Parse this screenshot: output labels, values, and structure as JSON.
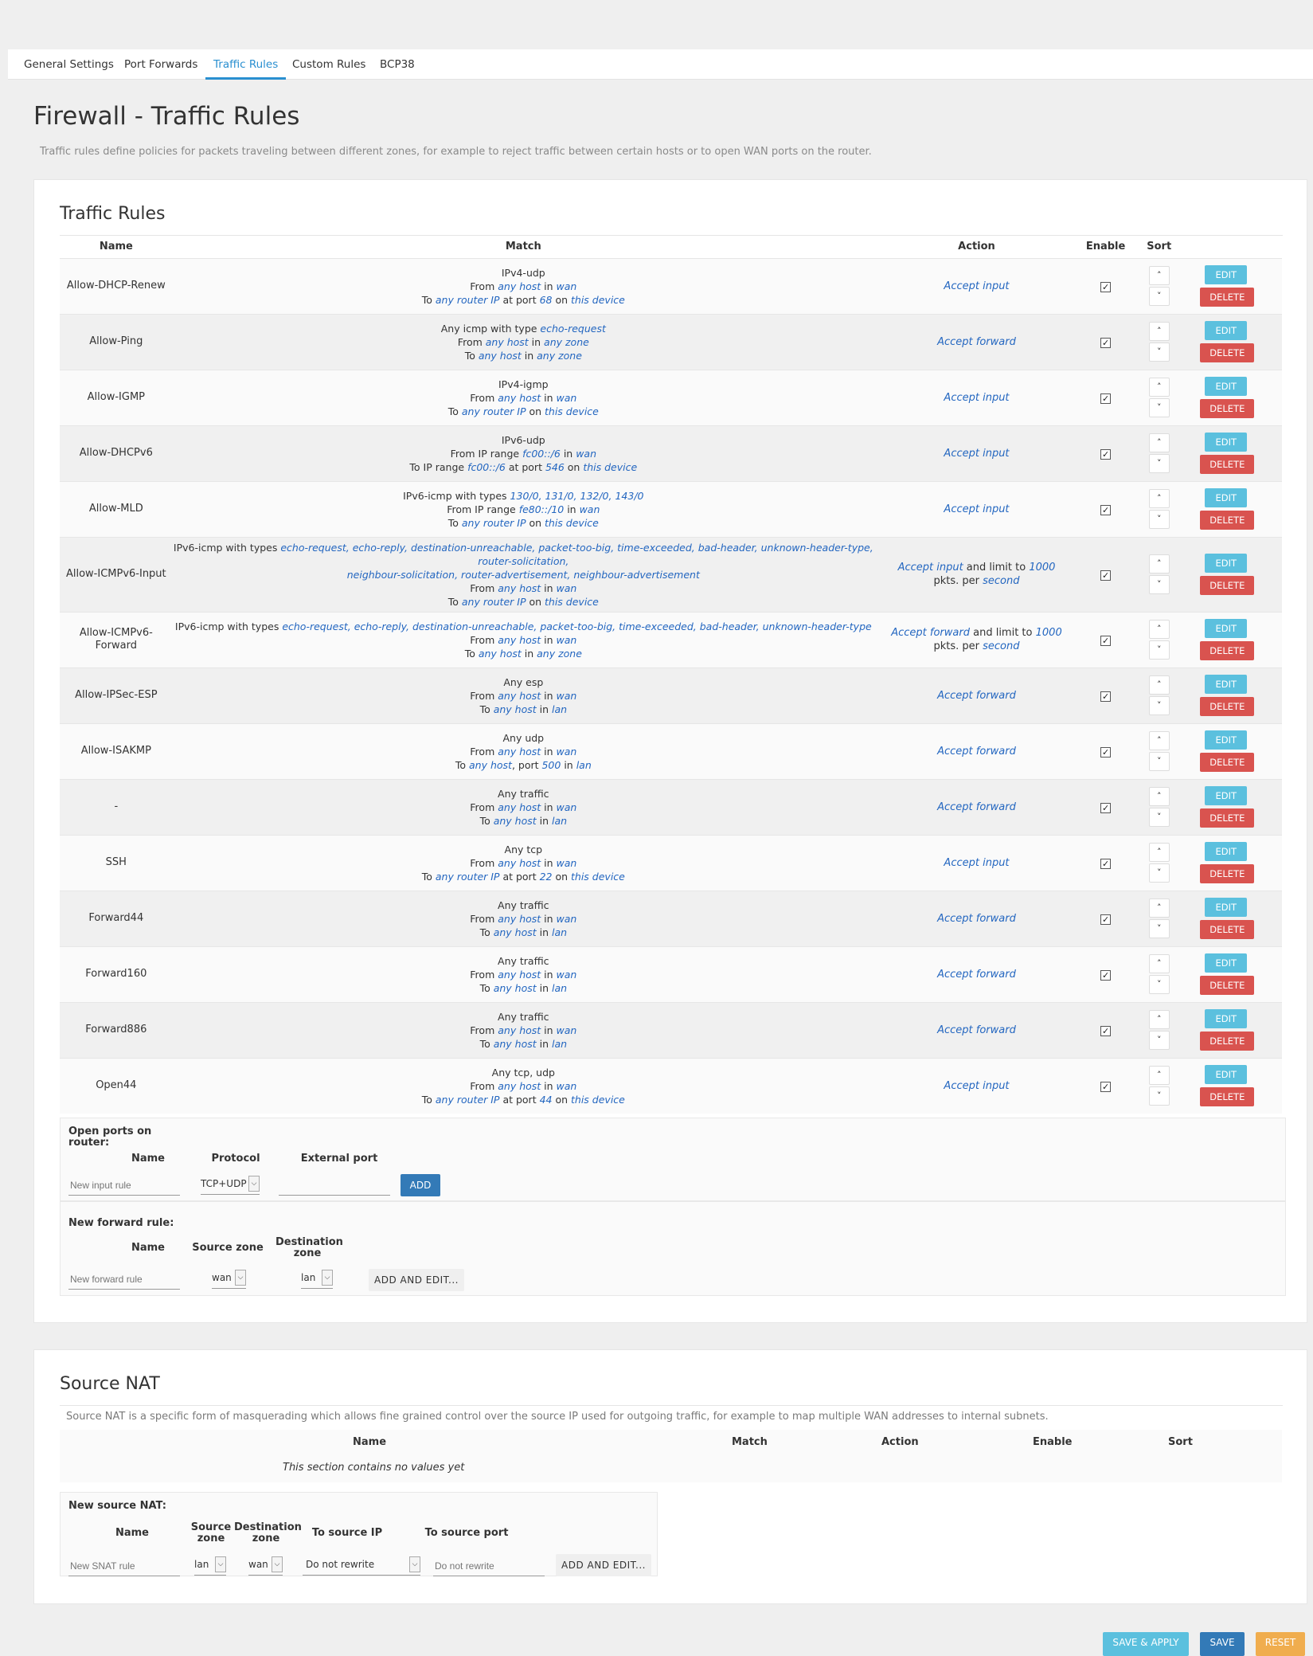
{
  "tabs": [
    "General Settings",
    "Port Forwards",
    "Traffic Rules",
    "Custom Rules",
    "BCP38"
  ],
  "page": {
    "title": "Firewall - Traffic Rules",
    "description": "Traffic rules define policies for packets traveling between different zones, for example to reject traffic between certain hosts or to open WAN ports on the router."
  },
  "traffic_rules": {
    "title": "Traffic Rules",
    "columns": [
      "Name",
      "Match",
      "Action",
      "Enable",
      "Sort"
    ],
    "edit_label": "EDIT",
    "delete_label": "DELETE",
    "rows": [
      {
        "name": "Allow-DHCP-Renew",
        "match": [
          "IPv4-udp",
          "From {any host} in {wan}",
          "To {any router IP} at port {68} on {this device}"
        ],
        "action": "{Accept input}",
        "enabled": true
      },
      {
        "name": "Allow-Ping",
        "match": [
          "Any icmp with type {echo-request}",
          "From {any host} in {any zone}",
          "To {any host} in {any zone}"
        ],
        "action": "{Accept forward}",
        "enabled": true
      },
      {
        "name": "Allow-IGMP",
        "match": [
          "IPv4-igmp",
          "From {any host} in {wan}",
          "To {any router IP} on {this device}"
        ],
        "action": "{Accept input}",
        "enabled": true
      },
      {
        "name": "Allow-DHCPv6",
        "match": [
          "IPv6-udp",
          "From IP range {fc00::/6} in {wan}",
          "To IP range {fc00::/6} at port {546} on {this device}"
        ],
        "action": "{Accept input}",
        "enabled": true
      },
      {
        "name": "Allow-MLD",
        "match": [
          "IPv6-icmp with types {130/0, 131/0, 132/0, 143/0}",
          "From IP range {fe80::/10} in {wan}",
          "To {any router IP} on {this device}"
        ],
        "action": "{Accept input}",
        "enabled": true
      },
      {
        "name": "Allow-ICMPv6-Input",
        "match": [
          "IPv6-icmp with types {echo-request, echo-reply, destination-unreachable, packet-too-big, time-exceeded, bad-header, unknown-header-type, router-solicitation,}",
          "{neighbour-solicitation, router-advertisement, neighbour-advertisement}",
          "From {any host} in {wan}",
          "To {any router IP} on {this device}"
        ],
        "action": "{Accept input} and limit to {1000} pkts. per {second}",
        "enabled": true
      },
      {
        "name": "Allow-ICMPv6-Forward",
        "match": [
          "IPv6-icmp with types {echo-request, echo-reply, destination-unreachable, packet-too-big, time-exceeded, bad-header, unknown-header-type}",
          "From {any host} in {wan}",
          "To {any host} in {any zone}"
        ],
        "action": "{Accept forward} and limit to {1000} pkts. per {second}",
        "enabled": true
      },
      {
        "name": "Allow-IPSec-ESP",
        "match": [
          "Any esp",
          "From {any host} in {wan}",
          "To {any host} in {lan}"
        ],
        "action": "{Accept forward}",
        "enabled": true
      },
      {
        "name": "Allow-ISAKMP",
        "match": [
          "Any udp",
          "From {any host} in {wan}",
          "To {any host}, port {500} in {lan}"
        ],
        "action": "{Accept forward}",
        "enabled": true
      },
      {
        "name": "-",
        "match": [
          "Any traffic",
          "From {any host} in {wan}",
          "To {any host} in {lan}"
        ],
        "action": "{Accept forward}",
        "enabled": true
      },
      {
        "name": "SSH",
        "match": [
          "Any tcp",
          "From {any host} in {wan}",
          "To {any router IP} at port {22} on {this device}"
        ],
        "action": "{Accept input}",
        "enabled": true
      },
      {
        "name": "Forward44",
        "match": [
          "Any traffic",
          "From {any host} in {wan}",
          "To {any host} in {lan}"
        ],
        "action": "{Accept forward}",
        "enabled": true
      },
      {
        "name": "Forward160",
        "match": [
          "Any traffic",
          "From {any host} in {wan}",
          "To {any host} in {lan}"
        ],
        "action": "{Accept forward}",
        "enabled": true
      },
      {
        "name": "Forward886",
        "match": [
          "Any traffic",
          "From {any host} in {wan}",
          "To {any host} in {lan}"
        ],
        "action": "{Accept forward}",
        "enabled": true
      },
      {
        "name": "Open44",
        "match": [
          "Any tcp, udp",
          "From {any host} in {wan}",
          "To {any router IP} at port {44} on {this device}"
        ],
        "action": "{Accept input}",
        "enabled": true
      }
    ]
  },
  "open_ports": {
    "title": "Open ports on router:",
    "col_name": "Name",
    "col_protocol": "Protocol",
    "col_external_port": "External port",
    "name_placeholder": "New input rule",
    "protocol_value": "TCP+UDP",
    "external_port_value": "",
    "add_label": "ADD"
  },
  "new_forward": {
    "title": "New forward rule:",
    "col_name": "Name",
    "col_source_zone": "Source zone",
    "col_dest_zone": "Destination zone",
    "name_placeholder": "New forward rule",
    "source_zone_value": "wan",
    "dest_zone_value": "lan",
    "add_edit_label": "ADD AND EDIT..."
  },
  "source_nat": {
    "title": "Source NAT",
    "description": "Source NAT is a specific form of masquerading which allows fine grained control over the source IP used for outgoing traffic, for example to map multiple WAN addresses to internal subnets.",
    "columns": [
      "Name",
      "Match",
      "Action",
      "Enable",
      "Sort"
    ],
    "empty_text": "This section contains no values yet"
  },
  "new_snat": {
    "title": "New source NAT:",
    "col_name": "Name",
    "col_source_zone": "Source zone",
    "col_dest_zone": "Destination zone",
    "col_to_source_ip": "To source IP",
    "col_to_source_port": "To source port",
    "name_placeholder": "New SNAT rule",
    "source_zone_value": "lan",
    "dest_zone_value": "wan",
    "to_source_ip_value": "Do not rewrite",
    "to_source_port_placeholder": "Do not rewrite",
    "add_edit_label": "ADD AND EDIT..."
  },
  "footer": {
    "save_apply_label": "SAVE & APPLY",
    "save_label": "SAVE",
    "reset_label": "RESET"
  },
  "colors": {
    "accent": "#2a8fd0",
    "link": "#2366c0",
    "edit": "#5bc0de",
    "delete": "#d9534f",
    "primary": "#337ab7",
    "reset": "#f0ad4e"
  }
}
